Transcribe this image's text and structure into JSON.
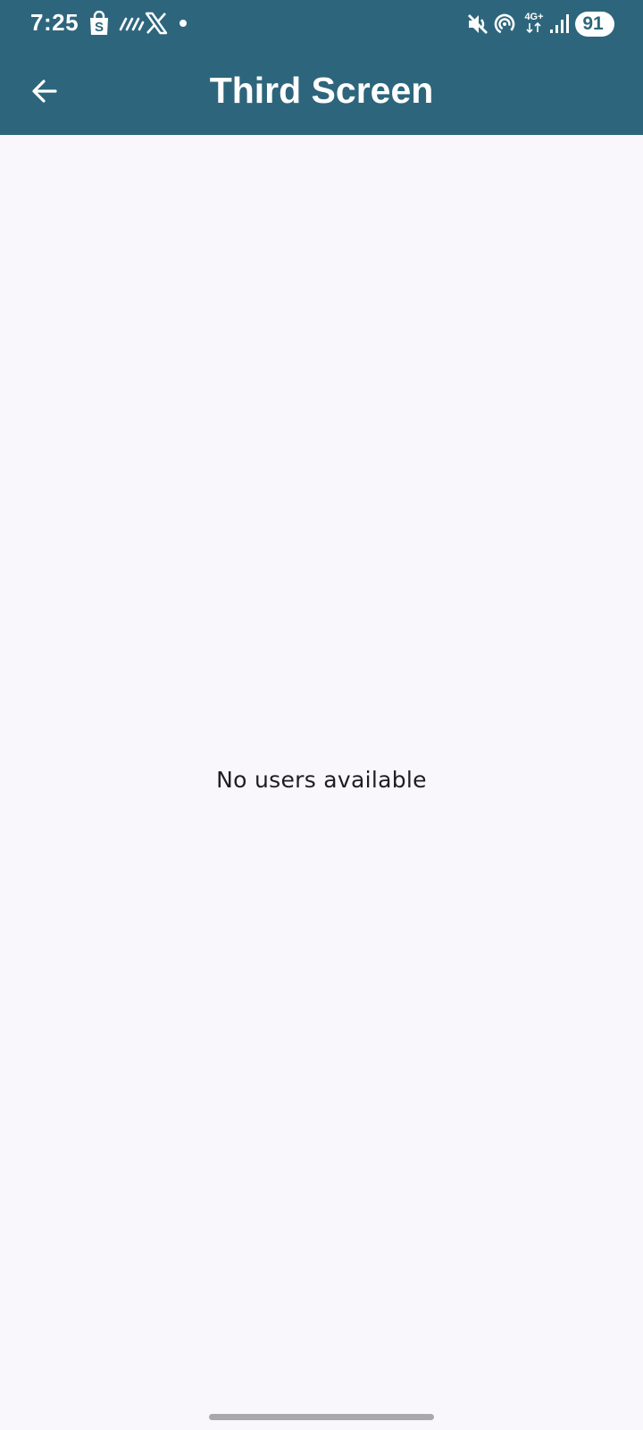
{
  "status_bar": {
    "time": "7:25",
    "network": "4G+",
    "battery": "91",
    "left_icons": [
      "shopping-bag-icon",
      "stripes-icon",
      "x-logo-icon",
      "dot-icon"
    ],
    "right_icons": [
      "mute-icon",
      "hotspot-icon",
      "network-4g-icon",
      "signal-icon",
      "battery-icon"
    ]
  },
  "app_bar": {
    "title": "Third Screen",
    "back_icon": "arrow-left-icon"
  },
  "main": {
    "empty_message": "No users available"
  },
  "colors": {
    "app_bar_background": "#2d667c",
    "page_background": "#f9f6fc",
    "text": "#1f1d24",
    "home_indicator": "#a9a7ad"
  }
}
